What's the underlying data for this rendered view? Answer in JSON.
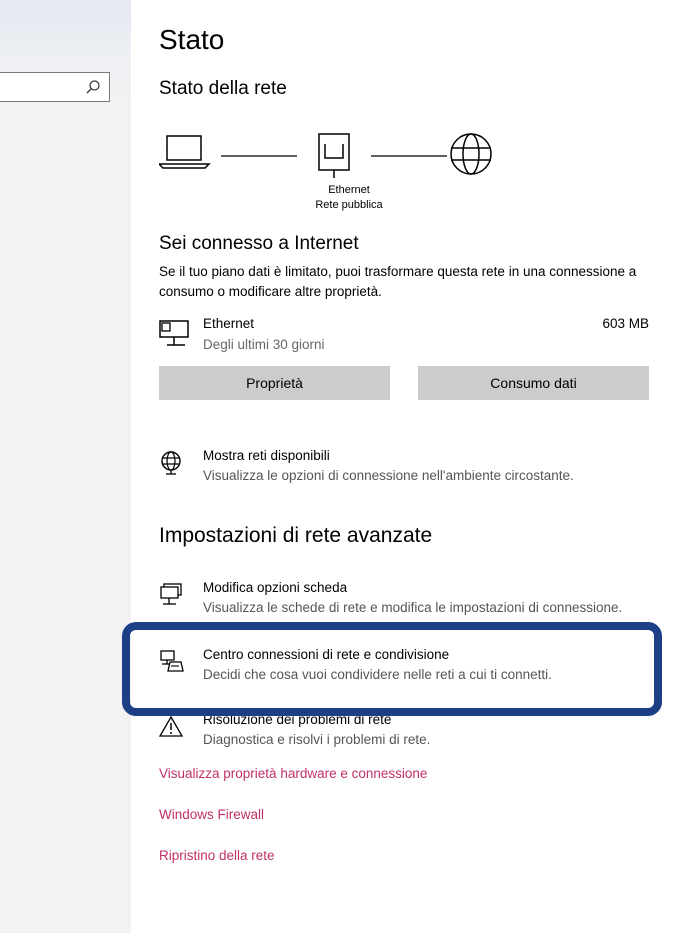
{
  "search": {
    "placeholder": "",
    "icon": "search-icon"
  },
  "page": {
    "title": "Stato"
  },
  "network_status": {
    "heading": "Stato della rete",
    "adapter_label": "Ethernet",
    "network_type": "Rete pubblica"
  },
  "connection": {
    "title": "Sei connesso a Internet",
    "description": "Se il tuo piano dati è limitato, puoi trasformare questa rete in una connessione a consumo o modificare altre proprietà.",
    "adapter": {
      "name": "Ethernet",
      "period": "Degli ultimi 30 giorni",
      "usage": "603 MB"
    },
    "buttons": {
      "properties": "Proprietà",
      "data_usage": "Consumo dati"
    }
  },
  "available_networks": {
    "title": "Mostra reti disponibili",
    "description": "Visualizza le opzioni di connessione nell'ambiente circostante."
  },
  "advanced": {
    "heading": "Impostazioni di rete avanzate",
    "items": [
      {
        "title": "Modifica opzioni scheda",
        "description": "Visualizza le schede di rete e modifica le impostazioni di connessione."
      },
      {
        "title": "Centro connessioni di rete e condivisione",
        "description": "Decidi che cosa vuoi condividere nelle reti a cui ti connetti."
      },
      {
        "title": "Risoluzione dei problemi di rete",
        "description": "Diagnostica e risolvi i problemi di rete."
      }
    ]
  },
  "links": {
    "hardware": "Visualizza proprietà hardware e connessione",
    "firewall": "Windows Firewall",
    "reset": "Ripristino della rete"
  },
  "colors": {
    "accent_link": "#c0306a",
    "highlight_border": "#1c3f86",
    "button_bg": "#cccccc"
  }
}
